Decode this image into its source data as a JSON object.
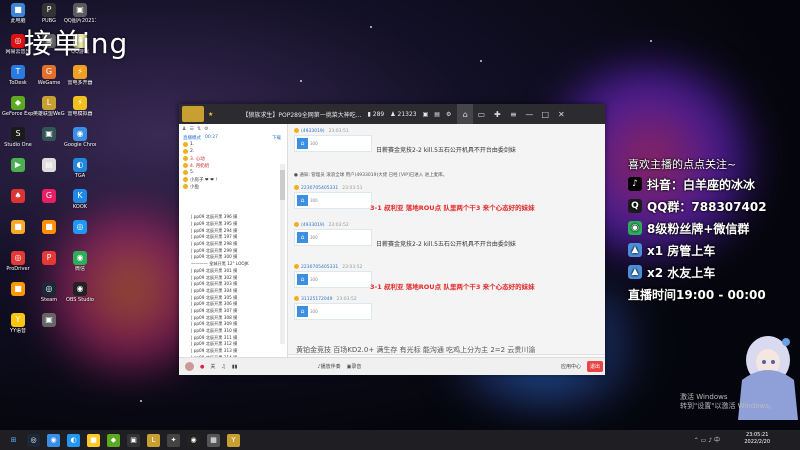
{
  "overlay": {
    "title": "接单ing"
  },
  "desktop": {
    "icons": [
      {
        "label": "此电脑",
        "color": "#3b84d6",
        "glyph": "■"
      },
      {
        "label": "PUBG",
        "color": "#333",
        "glyph": "P"
      },
      {
        "label": "QQ图片2021121...",
        "color": "#5b5b5b",
        "glyph": "▣"
      },
      {
        "label": "网易云音乐",
        "color": "#d11",
        "glyph": "◎"
      },
      {
        "label": "",
        "color": "#666",
        "glyph": "▣"
      },
      {
        "label": "QQ游戏",
        "color": "#eea",
        "glyph": "♣"
      },
      {
        "label": "ToDesk",
        "color": "#2a7be0",
        "glyph": "T"
      },
      {
        "label": "WeGame",
        "color": "#e0702a",
        "glyph": "G"
      },
      {
        "label": "雷电多开器",
        "color": "#f0a020",
        "glyph": "⚡"
      },
      {
        "label": "GeForce Experience",
        "color": "#5caa1f",
        "glyph": "◆"
      },
      {
        "label": "英雄联盟WeGame版",
        "color": "#c8a032",
        "glyph": "L"
      },
      {
        "label": "雷电模拟器",
        "color": "#f0c020",
        "glyph": "⚡"
      },
      {
        "label": "Studio One",
        "color": "#1a1a1a",
        "glyph": "S"
      },
      {
        "label": "",
        "color": "#355",
        "glyph": "▣"
      },
      {
        "label": "Google Chrome",
        "color": "#3a8ee6",
        "glyph": "◉"
      },
      {
        "label": "",
        "color": "#4caf50",
        "glyph": "▶"
      },
      {
        "label": "",
        "color": "#ddd",
        "glyph": "▤"
      },
      {
        "label": "TGA",
        "color": "#2288dd",
        "glyph": "◐"
      },
      {
        "label": "",
        "color": "#d33",
        "glyph": "♠"
      },
      {
        "label": "",
        "color": "#e91e63",
        "glyph": "G"
      },
      {
        "label": "KOOK",
        "color": "#1e88e5",
        "glyph": "K"
      },
      {
        "label": "",
        "color": "#f9a825",
        "glyph": "■"
      },
      {
        "label": "",
        "color": "#ff8f00",
        "glyph": "■"
      },
      {
        "label": "",
        "color": "#2196f3",
        "glyph": "◎"
      },
      {
        "label": "ProDriver",
        "color": "#e53935",
        "glyph": "◎"
      },
      {
        "label": "",
        "color": "#e53935",
        "glyph": "P"
      },
      {
        "label": "微信",
        "color": "#2bad5a",
        "glyph": "◉"
      },
      {
        "label": "",
        "color": "#ff9800",
        "glyph": "■"
      },
      {
        "label": "Steam",
        "color": "#1b2838",
        "glyph": "◎"
      },
      {
        "label": "OBS Studio",
        "color": "#222",
        "glyph": "◉"
      },
      {
        "label": "YY语音",
        "color": "#f9c513",
        "glyph": "Y"
      },
      {
        "label": "",
        "color": "#666",
        "glyph": "▣"
      }
    ]
  },
  "chat_window": {
    "title": "【狼族求生】POP289全网第一挑菜大神吃...",
    "count1": "289",
    "count2": "21323",
    "left_pane": {
      "header": "直播模式",
      "header_stat": "00:27",
      "header_action": "下载",
      "groups": [
        {
          "label": "1.",
          "red": false
        },
        {
          "label": "2.",
          "red": false
        },
        {
          "label": "3. 心动",
          "red": true
        },
        {
          "label": "4. 月奶奶",
          "red": true
        },
        {
          "label": "5.",
          "red": false
        },
        {
          "label": "小房子 ❤ ❤ !",
          "red": false
        },
        {
          "label": "小鱼",
          "red": false
        }
      ],
      "rows": [
        "| pp09  北辰开黑 396  摸",
        "| pp09  北辰开黑 395  摸",
        "| pp09  北辰开黑 294  摸",
        "| pp09  北辰开黑 197  摸",
        "| pp09  北辰开黑 298  摸",
        "| pp09  北辰开黑 299  摸",
        "| pp09  北辰开黑 300  摸",
        "———— 皇城开黑 12° LOOJK",
        "| pp09  北辰开黑 301  摸",
        "| pp09  北辰开黑 302  摸",
        "| pp09  北辰开黑 303  摸",
        "| pp09  北辰开黑 304  摸",
        "| pp09  北辰开黑 305  摸",
        "| pp09  北辰开黑 306  摸",
        "| pp09  北辰开黑 307  摸",
        "| pp09  北辰开黑 308  摸",
        "| pp09  北辰开黑 309  摸",
        "| pp09  北辰开黑 310  摸",
        "| pp09  北辰开黑 311  摸",
        "| pp09  北辰开黑 312  摸",
        "| pp09  北辰开黑 313  摸",
        "| pp09  北辰开黑 314  摸"
      ]
    },
    "messages": [
      {
        "who": "(4933019)",
        "time": "23:03:51",
        "text": "日薪赛金竞技2-2 kill.5五石公开机具不开台由委剑妹",
        "red": false
      },
      {
        "sys": "● 通知: 管理员 滚浪全球 用户(4933019)大佬 已经 [VIP]已进入 进上麦库。"
      },
      {
        "who": "2230705405331",
        "time": "23:03:51",
        "text": "3-1 叔利亚 落地ROU点 队里两个干3 来个心态好的妹妹",
        "red": true
      },
      {
        "who": "(4933019)",
        "time": "23:03:52",
        "text": "日薪赛金竞技2-2 kill.5五石公开机具不开台由委剑妹",
        "red": false
      },
      {
        "who": "2230705405331",
        "time": "23:03:52",
        "text": "3-1 叔利亚 落地ROU点 队里两个干3 来个心态好的妹妹",
        "red": true
      },
      {
        "who": "31125172049",
        "time": "23:03:52",
        "text": "",
        "red": false
      }
    ],
    "card_label": "300",
    "card_sub": "查看详情",
    "danmu": "黄铂金竞技 百场KD2.0+ 满生存 有光标 能沟通 吃鸡上分为主 2=2 云贵川渝",
    "input_placeholder": "说些什么吧...",
    "bottom": {
      "mic": "关",
      "music": "播放伴奏",
      "record": "录音",
      "gift": "应用中心",
      "exit": "退出"
    }
  },
  "right_overlay": {
    "lines": [
      {
        "text": "喜欢主播的点点关注~",
        "icon": "",
        "icon_color": ""
      },
      {
        "text": "抖音：白羊座的冰冰",
        "icon": "♪",
        "icon_color": "#000"
      },
      {
        "text": "QQ群：788307402",
        "icon": "Q",
        "icon_color": "#1b1b1b"
      },
      {
        "text": "8级粉丝牌+微信群",
        "icon": "◉",
        "icon_color": "#2bad5a"
      },
      {
        "text": "x1 房管上车",
        "icon": "▲",
        "icon_color": "#4a90d9"
      },
      {
        "text": "x2 水友上车",
        "icon": "▲",
        "icon_color": "#4a90d9"
      },
      {
        "text": "直播时间19:00 - 00:00",
        "icon": "",
        "icon_color": ""
      }
    ]
  },
  "watermark": {
    "line1": "激活 Windows",
    "line2": "转到\"设置\"以激活 Windows。"
  },
  "taskbar": {
    "time": "23:05:21",
    "date": "2022/2/20"
  }
}
